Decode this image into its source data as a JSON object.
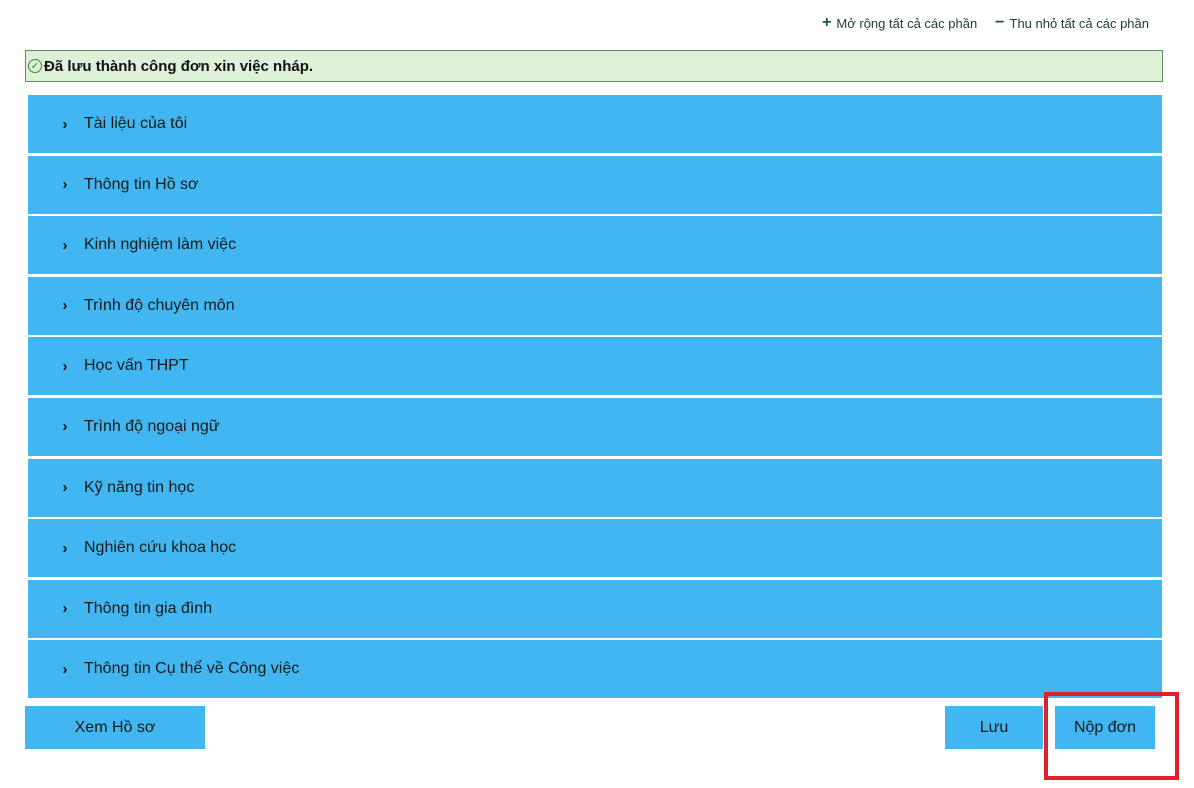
{
  "top_links": {
    "expand_all": "Mở rộng tất cả các phần",
    "collapse_all": "Thu nhỏ tất cả các phần",
    "expand_icon": "plus-icon",
    "collapse_icon": "minus-icon"
  },
  "alert": {
    "icon": "check-circle-icon",
    "message": "Đã lưu thành công đơn xin việc nháp."
  },
  "sections": [
    {
      "label": "Tài liệu của tôi"
    },
    {
      "label": "Thông tin Hồ sơ"
    },
    {
      "label": "Kinh nghiệm làm việc"
    },
    {
      "label": "Trình độ chuyên môn"
    },
    {
      "label": "Học vấn THPT"
    },
    {
      "label": "Trình độ ngoại ngữ"
    },
    {
      "label": "Kỹ năng tin học"
    },
    {
      "label": "Nghiên cứu khoa học"
    },
    {
      "label": "Thông tin gia đình"
    },
    {
      "label": "Thông tin Cụ thể về Công việc"
    }
  ],
  "buttons": {
    "view_profile": "Xem Hồ sơ",
    "save": "Lưu",
    "submit": "Nộp đơn"
  },
  "colors": {
    "accent": "#42b6f0",
    "alert_bg": "#dff0d8",
    "highlight": "#e0202a"
  }
}
